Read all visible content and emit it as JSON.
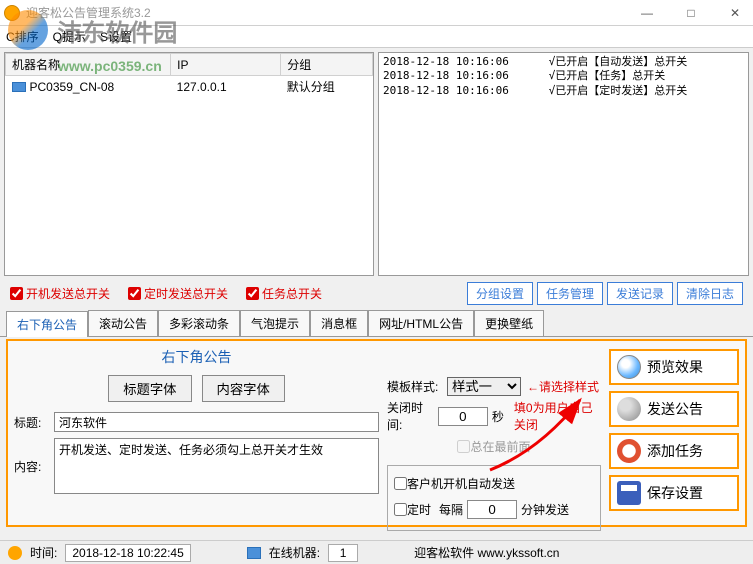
{
  "watermark": {
    "text": "沛东软件园",
    "url": "www.pc0359.cn"
  },
  "titlebar": {
    "title": "迎客松公告管理系统3.2"
  },
  "menu": {
    "sort": "C排序",
    "hint": "Q提示",
    "setting": "S设置"
  },
  "table": {
    "headers": {
      "name": "机器名称",
      "ip": "IP",
      "group": "分组"
    },
    "rows": [
      {
        "name": "PC0359_CN-08",
        "ip": "127.0.0.1",
        "group": "默认分组"
      }
    ]
  },
  "log": [
    {
      "time": "2018-12-18 10:16:06",
      "msg": "√已开启【自动发送】总开关"
    },
    {
      "time": "2018-12-18 10:16:06",
      "msg": "√已开启【任务】总开关"
    },
    {
      "time": "2018-12-18 10:16:06",
      "msg": "√已开启【定时发送】总开关"
    }
  ],
  "checks": {
    "autosend": "开机发送总开关",
    "timedsend": "定时发送总开关",
    "task": "任务总开关"
  },
  "bluebtns": {
    "group": "分组设置",
    "taskmgr": "任务管理",
    "sendlog": "发送记录",
    "clearlog": "清除日志"
  },
  "tabs": [
    "右下角公告",
    "滚动公告",
    "多彩滚动条",
    "气泡提示",
    "消息框",
    "网址/HTML公告",
    "更换壁纸"
  ],
  "panel": {
    "title": "右下角公告",
    "fontTitleBtn": "标题字体",
    "fontBodyBtn": "内容字体",
    "labelTitle": "标题:",
    "labelBody": "内容:",
    "valTitle": "河东软件",
    "valBody": "开机发送、定时发送、任务必须勾上总开关才生效",
    "styleLabel": "模板样式:",
    "styleSelected": "样式一",
    "styleHint": "←请选择样式",
    "closeLabel": "关闭时间:",
    "closeVal": "0",
    "closeUnit": "秒",
    "closeHint": "填0为用户自己关闭",
    "topmost": "总在最前面",
    "clientAutoSend": "客户机开机自动发送",
    "timed": "定时",
    "interval": "每隔",
    "intervalVal": "0",
    "intervalUnit": "分钟发送"
  },
  "bigbtns": {
    "preview": "预览效果",
    "send": "发送公告",
    "addtask": "添加任务",
    "save": "保存设置"
  },
  "status": {
    "timeLabel": "时间:",
    "time": "2018-12-18 10:22:45",
    "onlineLabel": "在线机器:",
    "online": "1",
    "brand": "迎客松软件 www.ykssoft.cn"
  }
}
